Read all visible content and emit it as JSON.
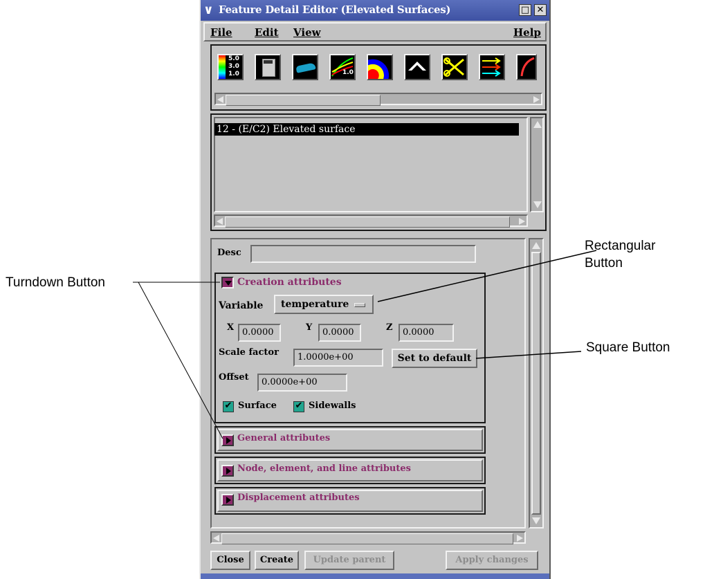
{
  "window": {
    "title": "Feature Detail Editor (Elevated Surfaces)",
    "controls": [
      "□",
      "✕"
    ]
  },
  "menubar": {
    "file": "File",
    "edit": "Edit",
    "view": "View",
    "help": "Help"
  },
  "toolbox": {
    "icons": [
      "color-legend-icon",
      "calculator-icon",
      "car-model-icon",
      "line-plot-icon",
      "isosurface-icon",
      "elevated-surface-icon",
      "clip-icon",
      "vector-arrows-icon",
      "particle-trace-icon"
    ],
    "legend_values": [
      "5.0",
      "3.0",
      "1.0"
    ],
    "plot_label": "1.0"
  },
  "part_list": {
    "selected_item": "12 - (E/C2) Elevated surface"
  },
  "attributes": {
    "desc_label": "Desc",
    "desc_value": "",
    "creation": {
      "title": "Creation attributes",
      "variable_label": "Variable",
      "variable_value": "temperature",
      "x_label": "X",
      "x_value": "0.0000",
      "y_label": "Y",
      "y_value": "0.0000",
      "z_label": "Z",
      "z_value": "0.0000",
      "scale_label": "Scale factor",
      "scale_value": "1.0000e+00",
      "set_default": "Set to default",
      "offset_label": "Offset",
      "offset_value": "0.0000e+00",
      "surface_label": "Surface",
      "sidewalls_label": "Sidewalls"
    },
    "general_title": "General attributes",
    "node_title": "Node, element, and line attributes",
    "displacement_title": "Displacement attributes"
  },
  "buttons": {
    "close": "Close",
    "create": "Create",
    "update_parent": "Update parent",
    "apply_changes": "Apply changes"
  },
  "annotations": {
    "turndown": "Turndown Button",
    "rectangular_1": "Rectangular",
    "rectangular_2": "Button",
    "square": "Square Button"
  },
  "colors": {
    "section_title": "#8b2b6b",
    "check": "#21a58f",
    "titlebar": "#4a5eb0"
  }
}
